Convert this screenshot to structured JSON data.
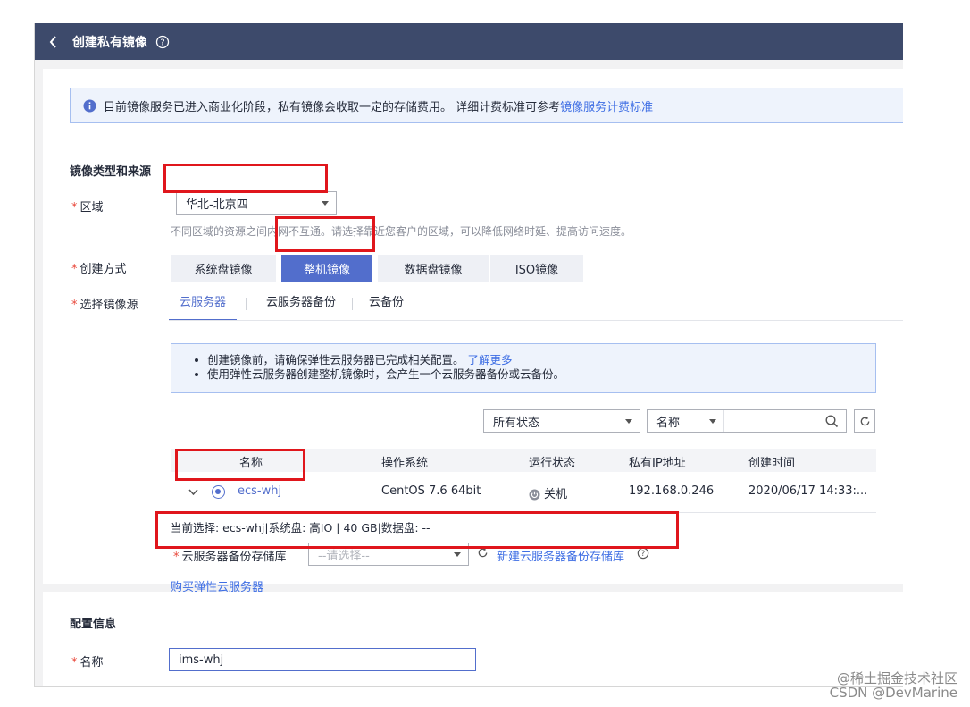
{
  "window": {
    "title": "创建私有镜像"
  },
  "notice": {
    "text": "目前镜像服务已进入商业化阶段，私有镜像会收取一定的存储费用。 详细计费标准可参考",
    "link": "镜像服务计费标准"
  },
  "section_source": {
    "title": "镜像类型和来源"
  },
  "region": {
    "label": "区域",
    "value": "华北-北京四",
    "hint": "不同区域的资源之间内网不互通。请选择靠近您客户的区域，可以降低网络时延、提高访问速度。"
  },
  "creation": {
    "label": "创建方式",
    "options": [
      "系统盘镜像",
      "整机镜像",
      "数据盘镜像",
      "ISO镜像"
    ],
    "selected": "整机镜像"
  },
  "source": {
    "label": "选择镜像源",
    "tabs": [
      "云服务器",
      "云服务器备份",
      "云备份"
    ],
    "active_tab": "云服务器"
  },
  "tips": {
    "line1": "创建镜像前，请确保弹性云服务器已完成相关配置。",
    "line1_link": "了解更多",
    "line2": "使用弹性云服务器创建整机镜像时，会产生一个云服务器备份或云备份。"
  },
  "filters": {
    "status": "所有状态",
    "search_field": "名称",
    "search_value": ""
  },
  "table": {
    "columns": [
      "名称",
      "操作系统",
      "运行状态",
      "私有IP地址",
      "创建时间"
    ],
    "rows": [
      {
        "name": "ecs-whj",
        "os": "CentOS 7.6 64bit",
        "status": "关机",
        "ip": "192.168.0.246",
        "created": "2020/06/17 14:33:..."
      }
    ]
  },
  "current_selection": "当前选择: ecs-whj|系统盘: 高IO | 40 GB|数据盘: --",
  "backup_repo": {
    "label": "云服务器备份存储库",
    "placeholder": "--请选择--",
    "create_link": "新建云服务器备份存储库"
  },
  "buy_link": "购买弹性云服务器",
  "section_config": {
    "title": "配置信息"
  },
  "name_field": {
    "label": "名称",
    "value": "ims-whj"
  },
  "watermark": {
    "line1": "@稀土掘金技术社区",
    "line2": "CSDN @DevMarine"
  },
  "colors": {
    "header": "#3d4a6b",
    "primary": "#526ecc",
    "link": "#3e6ee4",
    "highlight": "#e0161c",
    "required": "#e9483b"
  }
}
